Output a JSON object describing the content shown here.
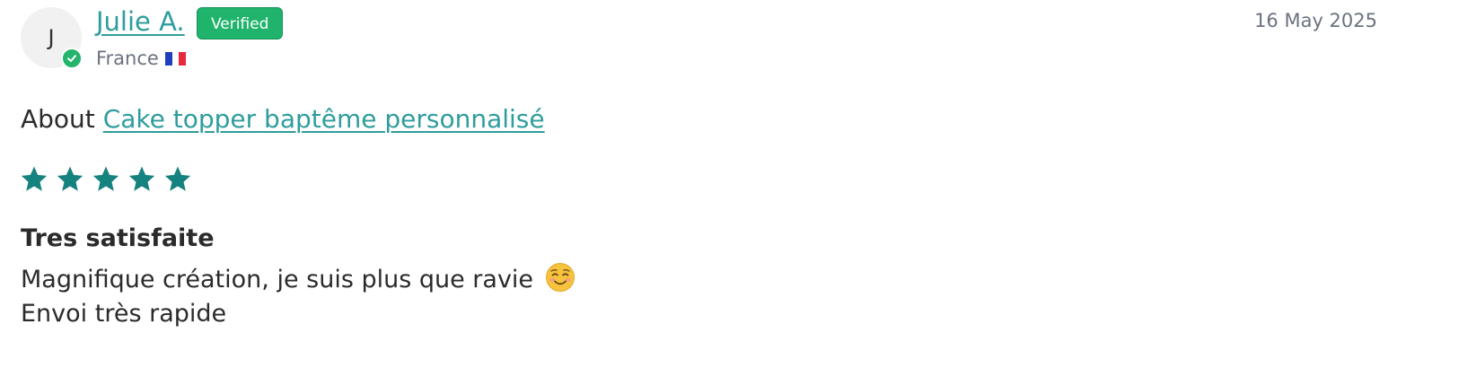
{
  "reviewer": {
    "initial": "J",
    "name": "Julie A.",
    "verified_label": "Verified",
    "country": "France",
    "flag_icon": "france-flag-icon"
  },
  "date": "16 May 2025",
  "about": {
    "prefix": "About",
    "product": "Cake topper baptême personnalisé"
  },
  "rating": {
    "value": 5,
    "max": 5,
    "star_color": "#14827f"
  },
  "review": {
    "title": "Tres satisfaite",
    "lines": [
      "Magnifique création, je suis plus que ravie",
      "Envoi très rapide"
    ],
    "emoji_icon": "smiling-face-icon"
  },
  "colors": {
    "link": "#2f9d9d",
    "verified_badge": "#1fb36b",
    "secondary_text": "#6b7280"
  }
}
